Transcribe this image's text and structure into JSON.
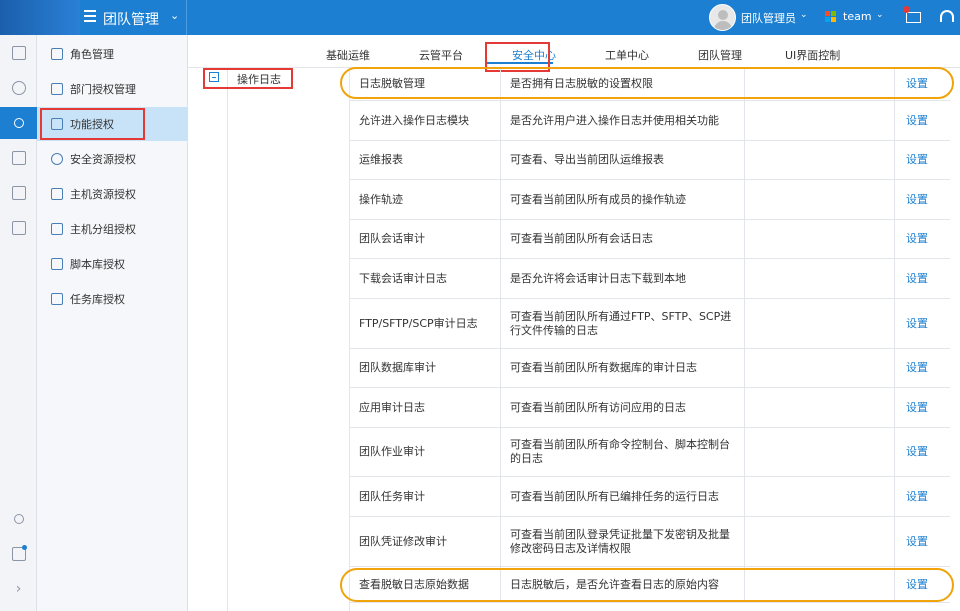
{
  "header": {
    "app_title": "团队管理",
    "user_name": "团队管理员",
    "team_name": "team"
  },
  "colors": {
    "primary": "#1c7fd1",
    "annotation_red": "#e53935",
    "annotation_orange": "#f0a30a"
  },
  "rail": {
    "icons": [
      "document-icon",
      "users-icon",
      "user-settings-icon",
      "list-icon",
      "clipboard-icon",
      "book-icon",
      "search-icon",
      "task-check-icon",
      "chevron-right-icon"
    ]
  },
  "menu": {
    "items": [
      {
        "label": "角色管理"
      },
      {
        "label": "部门授权管理"
      },
      {
        "label": "功能授权"
      },
      {
        "label": "安全资源授权"
      },
      {
        "label": "主机资源授权"
      },
      {
        "label": "主机分组授权"
      },
      {
        "label": "脚本库授权"
      },
      {
        "label": "任务库授权"
      }
    ]
  },
  "tabs": [
    {
      "label": "基础运维"
    },
    {
      "label": "云管平台"
    },
    {
      "label": "安全中心"
    },
    {
      "label": "工单中心"
    },
    {
      "label": "团队管理"
    },
    {
      "label": "UI界面控制"
    }
  ],
  "group": {
    "label": "操作日志"
  },
  "rows": [
    {
      "name": "日志脱敏管理",
      "desc": "是否拥有日志脱敏的设置权限",
      "action": "设置"
    },
    {
      "name": "允许进入操作日志模块",
      "desc": "是否允许用户进入操作日志并使用相关功能",
      "action": "设置"
    },
    {
      "name": "运维报表",
      "desc": "可查看、导出当前团队运维报表",
      "action": "设置"
    },
    {
      "name": "操作轨迹",
      "desc": "可查看当前团队所有成员的操作轨迹",
      "action": "设置"
    },
    {
      "name": "团队会话审计",
      "desc": "可查看当前团队所有会话日志",
      "action": "设置"
    },
    {
      "name": "下载会话审计日志",
      "desc": "是否允许将会话审计日志下载到本地",
      "action": "设置"
    },
    {
      "name": "FTP/SFTP/SCP审计日志",
      "desc": "可查看当前团队所有通过FTP、SFTP、SCP进行文件传输的日志",
      "action": "设置"
    },
    {
      "name": "团队数据库审计",
      "desc": "可查看当前团队所有数据库的审计日志",
      "action": "设置"
    },
    {
      "name": "应用审计日志",
      "desc": "可查看当前团队所有访问应用的日志",
      "action": "设置"
    },
    {
      "name": "团队作业审计",
      "desc": "可查看当前团队所有命令控制台、脚本控制台的日志",
      "action": "设置"
    },
    {
      "name": "团队任务审计",
      "desc": "可查看当前团队所有已编排任务的运行日志",
      "action": "设置"
    },
    {
      "name": "团队凭证修改审计",
      "desc": "可查看当前团队登录凭证批量下发密钥及批量修改密码日志及详情权限",
      "action": "设置"
    },
    {
      "name": "查看脱敏日志原始数据",
      "desc": "日志脱敏后，是否允许查看日志的原始内容",
      "action": "设置"
    }
  ]
}
